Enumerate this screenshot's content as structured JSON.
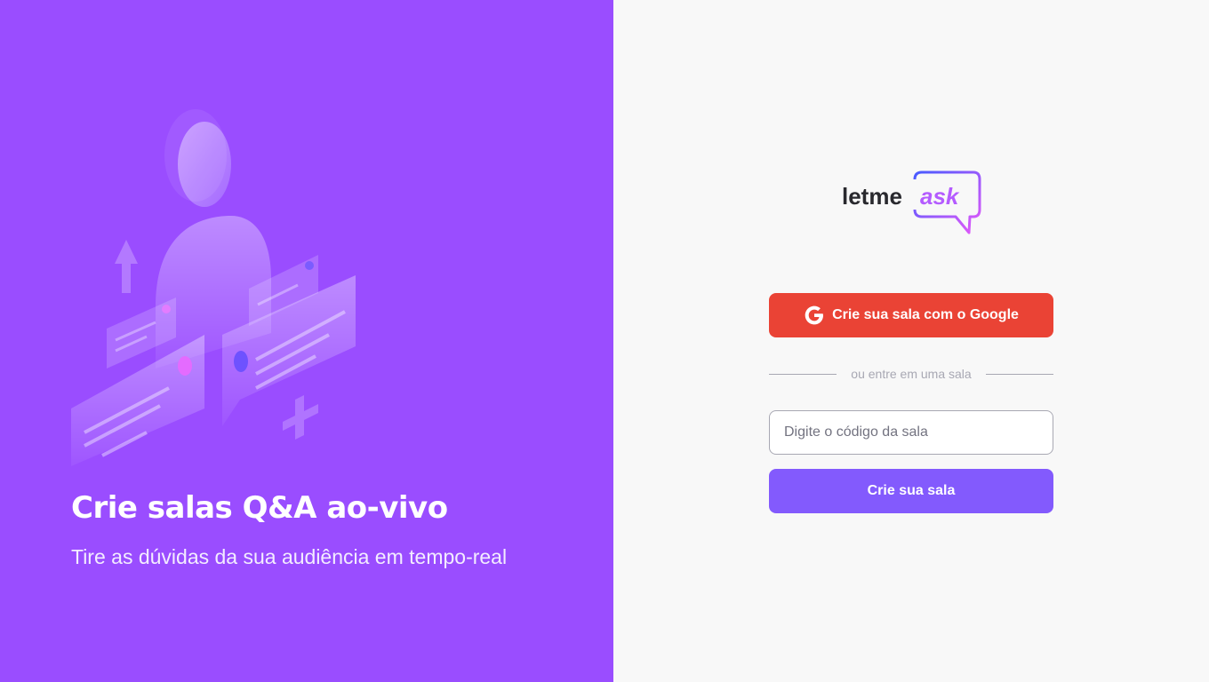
{
  "aside": {
    "title": "Crie salas Q&A ao-vivo",
    "subtitle": "Tire as dúvidas da sua audiência em tempo-real",
    "illustration": "illustration-person-chat-bubbles"
  },
  "logo": {
    "text_primary": "letme",
    "text_accent": "ask"
  },
  "google_button": {
    "label": "Crie sua sala com o Google",
    "icon": "google-icon"
  },
  "separator": {
    "text": "ou entre em uma sala"
  },
  "room_form": {
    "input_placeholder": "Digite o código da sala",
    "input_value": "",
    "submit_label": "Crie sua sala"
  },
  "colors": {
    "aside_bg": "#9a4dff",
    "google_red": "#ea4335",
    "primary_purple": "#835afd",
    "page_bg": "#f8f8f8"
  }
}
